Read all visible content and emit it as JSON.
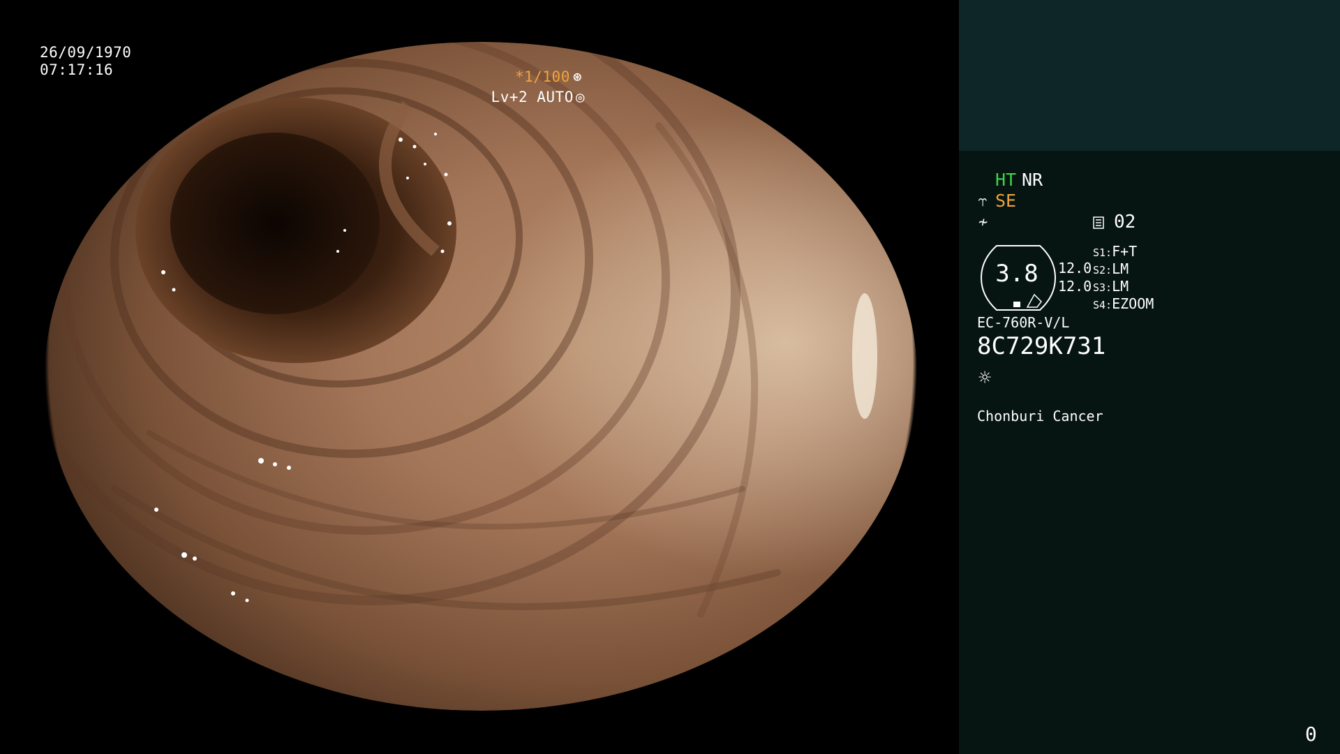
{
  "overlay": {
    "date": "26/09/1970",
    "time": "07:17:16",
    "shutter": "*1/100",
    "shutter_icon": "shutter-icon",
    "shutter_symbol": "⊛",
    "level": "Lv+2 AUTO",
    "level_icon": "iris-icon",
    "level_symbol": "◎",
    "shutter_color": "#f0a43a"
  },
  "panel": {
    "ht": "HT",
    "nr": "NR",
    "se_icon": "probe-icon",
    "se_symbol": "⥾",
    "se": "SE",
    "filter_icon": "filter-icon",
    "filter_symbol": "≁",
    "memory_icon": "memory-icon",
    "memory": "02",
    "zoom": "3.8",
    "zoom_min": "12.0",
    "zoom_max": "12.0",
    "switches": [
      {
        "key": "S1:",
        "value": "F+T"
      },
      {
        "key": "S2:",
        "value": "LM"
      },
      {
        "key": "S3:",
        "value": "LM"
      },
      {
        "key": "S4:",
        "value": "EZOOM"
      }
    ],
    "scope_model": "EC-760R-V/L",
    "scope_serial": "8C729K731",
    "light_icon": "light-icon",
    "light_symbol": "☼",
    "hospital": "Chonburi Cancer",
    "frame_counter": "0",
    "colors": {
      "ht": "#3fd34a",
      "se": "#f0a43a",
      "panel_bg": "#061412",
      "patient_box_bg": "#0f2628"
    }
  }
}
